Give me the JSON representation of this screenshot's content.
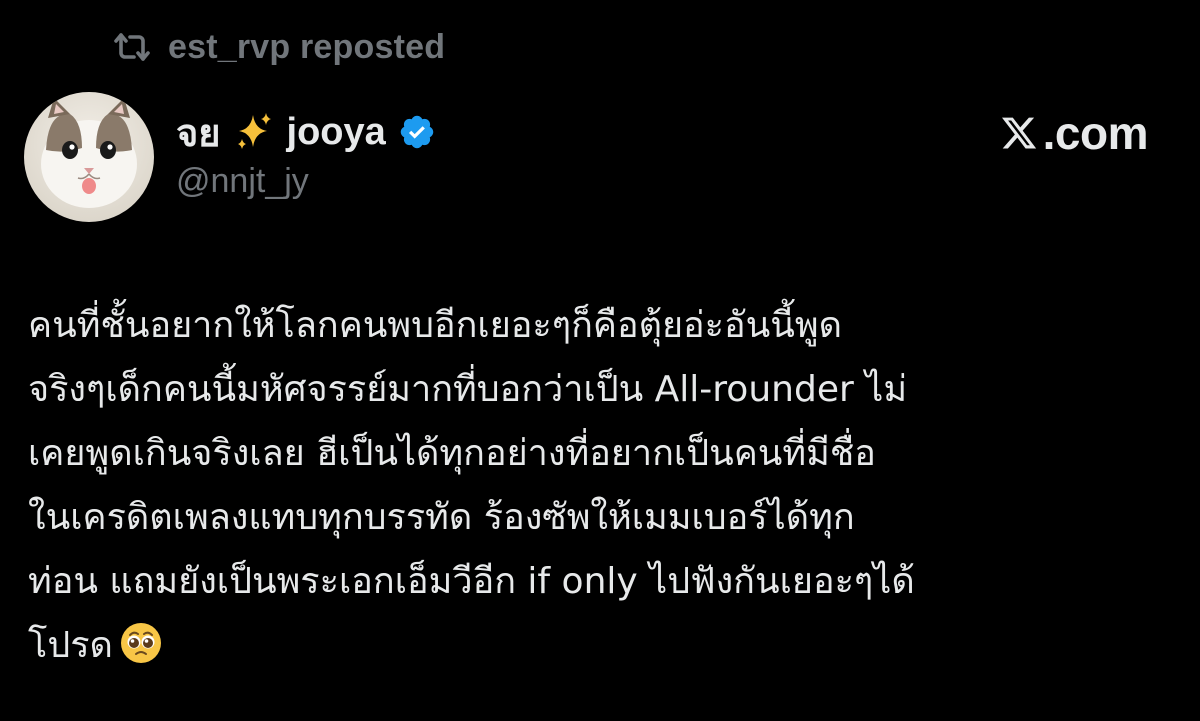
{
  "repost": {
    "icon": "repost-icon",
    "text": "est_rvp reposted"
  },
  "author": {
    "avatar_icon": "cat-avatar",
    "name_prefix": "จย",
    "name_emoji_icon": "sparkles-icon",
    "name_suffix": "jooya",
    "verified_icon": "verified-badge-icon",
    "verified_color": "#1d9bf0",
    "handle": "@nnjt_jy"
  },
  "brand": {
    "logo_icon": "x-logo-icon",
    "text": ".com"
  },
  "tweet": {
    "lines": [
      "คนที่ชั้นอยากให้โลกคนพบอีกเยอะๆก็คือตุ้ยอ่ะอันนี้พูด",
      "จริงๆเด็กคนนี้มหัศจรรย์มากที่บอกว่าเป็น All-rounder ไม่",
      "เคยพูดเกินจริงเลย ฮีเป็นได้ทุกอย่างที่อยากเป็นคนที่มีชื่อ",
      "ในเครดิตเพลงแทบทุกบรรทัด ร้องซัพให้เมมเบอร์ได้ทุก",
      "ท่อน แถมยังเป็นพระเอกเอ็มวีอีก if only ไปฟังกันเยอะๆได้",
      "โปรด"
    ],
    "trailing_emoji_icon": "pleading-face-emoji-icon"
  },
  "colors": {
    "background": "#000000",
    "primary_text": "#e7e9ea",
    "secondary_text": "#71767b"
  }
}
